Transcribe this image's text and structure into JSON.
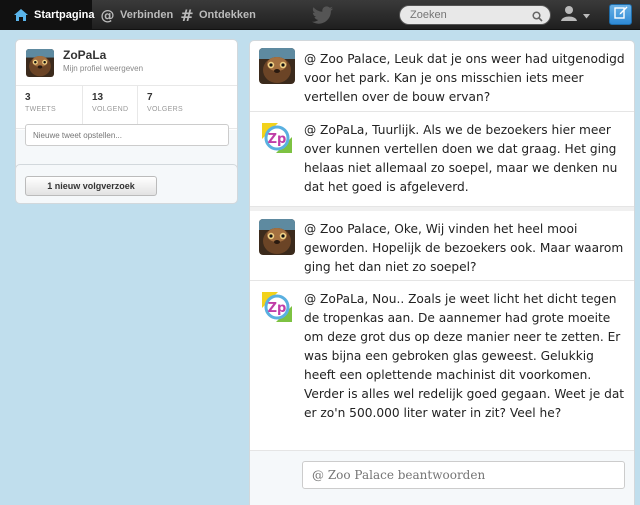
{
  "nav": {
    "home_label": "Startpagina",
    "connect_label": "Verbinden",
    "discover_label": "Ontdekken"
  },
  "search": {
    "placeholder": "Zoeken"
  },
  "colors": {
    "accent": "#2e8ad6",
    "topbar": "#2a2a2a",
    "background": "#c0deed"
  },
  "profile": {
    "name": "ZoPaLa",
    "link": "Mijn profiel weergeven",
    "stats": [
      {
        "value": "3",
        "label": "TWEETS"
      },
      {
        "value": "13",
        "label": "VOLGEND"
      },
      {
        "value": "7",
        "label": "VOLGERS"
      }
    ],
    "compose_placeholder": "Nieuwe tweet opstellen..."
  },
  "follow_requests": {
    "button_label": "1 nieuw volgverzoek"
  },
  "tweets": [
    {
      "avatar": "animal-photo-avatar",
      "text": "@ Zoo Palace, Leuk dat je ons weer had uitgenodigd voor het park. Kan je ons misschien iets meer vertellen over de bouw ervan?"
    },
    {
      "avatar": "zp-logo-avatar",
      "text": "@ ZoPaLa, Tuurlijk. Als we de bezoekers hier meer over kunnen vertellen doen we dat graag. Het ging helaas niet allemaal zo soepel, maar we denken nu dat het goed is afgeleverd."
    },
    {
      "avatar": "animal-photo-avatar",
      "text": "@ Zoo Palace, Oke, Wij vinden het heel mooi geworden. Hopelijk de bezoekers ook. Maar waarom ging het dan niet zo soepel?"
    },
    {
      "avatar": "zp-logo-avatar",
      "text": "@ ZoPaLa, Nou.. Zoals je weet licht het dicht tegen de tropenkas aan. De aannemer had grote moeite om deze grot dus op deze manier neer te zetten. Er was bijna een gebroken glas geweest. Gelukkig heeft een oplettende machinist dit voorkomen. Verder is alles wel redelijk goed gegaan. Weet je dat er zo'n 500.000 liter water in zit? Veel he?"
    }
  ],
  "reply": {
    "placeholder": "@ Zoo Palace beantwoorden"
  }
}
